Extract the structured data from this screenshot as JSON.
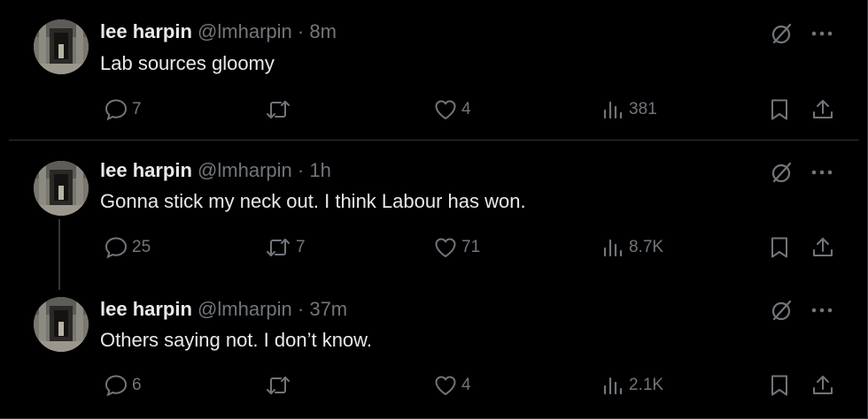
{
  "tweets": [
    {
      "name": "lee harpin",
      "handle": "@lmharpin",
      "separator": "·",
      "time": "8m",
      "text": "Lab sources gloomy",
      "replies": "7",
      "retweets": "",
      "likes": "4",
      "views": "381"
    },
    {
      "name": "lee harpin",
      "handle": "@lmharpin",
      "separator": "·",
      "time": "1h",
      "text": "Gonna stick my neck out. I think Labour has won.",
      "replies": "25",
      "retweets": "7",
      "likes": "71",
      "views": "8.7K"
    },
    {
      "name": "lee harpin",
      "handle": "@lmharpin",
      "separator": "·",
      "time": "37m",
      "text": "Others saying not. I don’t know.",
      "replies": "6",
      "retweets": "",
      "likes": "4",
      "views": "2.1K"
    }
  ],
  "icons": {
    "reply": "reply-icon",
    "retweet": "retweet-icon",
    "like": "heart-icon",
    "views": "analytics-icon",
    "bookmark": "bookmark-icon",
    "share": "share-icon",
    "grok": "grok-icon",
    "more": "more-icon"
  },
  "colors": {
    "background": "#000000",
    "text": "#e7e9ea",
    "muted": "#71767b",
    "border": "#2f3336"
  }
}
